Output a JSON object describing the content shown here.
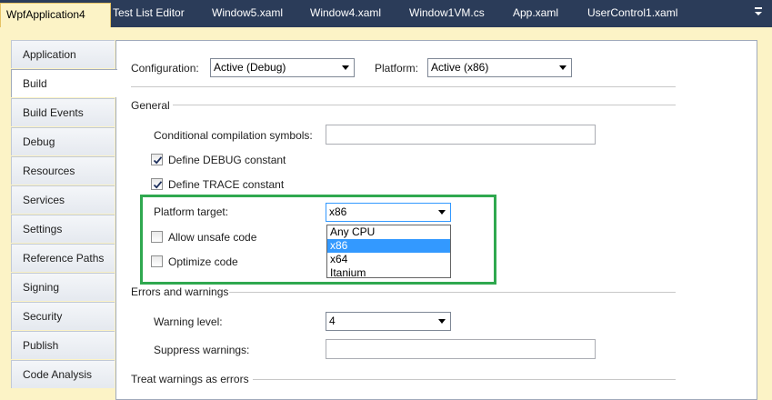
{
  "tabs": [
    {
      "label": "WpfApplication4",
      "active": true
    },
    {
      "label": "Test List Editor",
      "active": false
    },
    {
      "label": "Window5.xaml",
      "active": false
    },
    {
      "label": "Window4.xaml",
      "active": false
    },
    {
      "label": "Window1VM.cs",
      "active": false
    },
    {
      "label": "App.xaml",
      "active": false
    },
    {
      "label": "UserControl1.xaml",
      "active": false
    }
  ],
  "sidebar": {
    "items": [
      {
        "label": "Application"
      },
      {
        "label": "Build",
        "selected": true
      },
      {
        "label": "Build Events"
      },
      {
        "label": "Debug"
      },
      {
        "label": "Resources"
      },
      {
        "label": "Services"
      },
      {
        "label": "Settings"
      },
      {
        "label": "Reference Paths"
      },
      {
        "label": "Signing"
      },
      {
        "label": "Security"
      },
      {
        "label": "Publish"
      },
      {
        "label": "Code Analysis"
      }
    ]
  },
  "config": {
    "configuration_label": "Configuration:",
    "configuration_value": "Active (Debug)",
    "platform_label": "Platform:",
    "platform_value": "Active (x86)"
  },
  "general": {
    "header": "General",
    "conditional_label": "Conditional compilation symbols:",
    "conditional_value": "",
    "define_debug_label": "Define DEBUG constant",
    "define_debug_checked": true,
    "define_trace_label": "Define TRACE constant",
    "define_trace_checked": true,
    "platform_target_label": "Platform target:",
    "platform_target_value": "x86",
    "platform_options": [
      "Any CPU",
      "x86",
      "x64",
      "Itanium"
    ],
    "platform_selected": "x86",
    "allow_unsafe_label": "Allow unsafe code",
    "allow_unsafe_checked": false,
    "optimize_label": "Optimize code",
    "optimize_checked": false
  },
  "errors": {
    "header": "Errors and warnings",
    "warning_level_label": "Warning level:",
    "warning_level_value": "4",
    "suppress_label": "Suppress warnings:",
    "suppress_value": ""
  },
  "treat_warnings": {
    "header": "Treat warnings as errors"
  },
  "colors": {
    "highlight_box": "#2fa84f",
    "selection": "#3399ff",
    "chrome": "#2b3c59"
  }
}
